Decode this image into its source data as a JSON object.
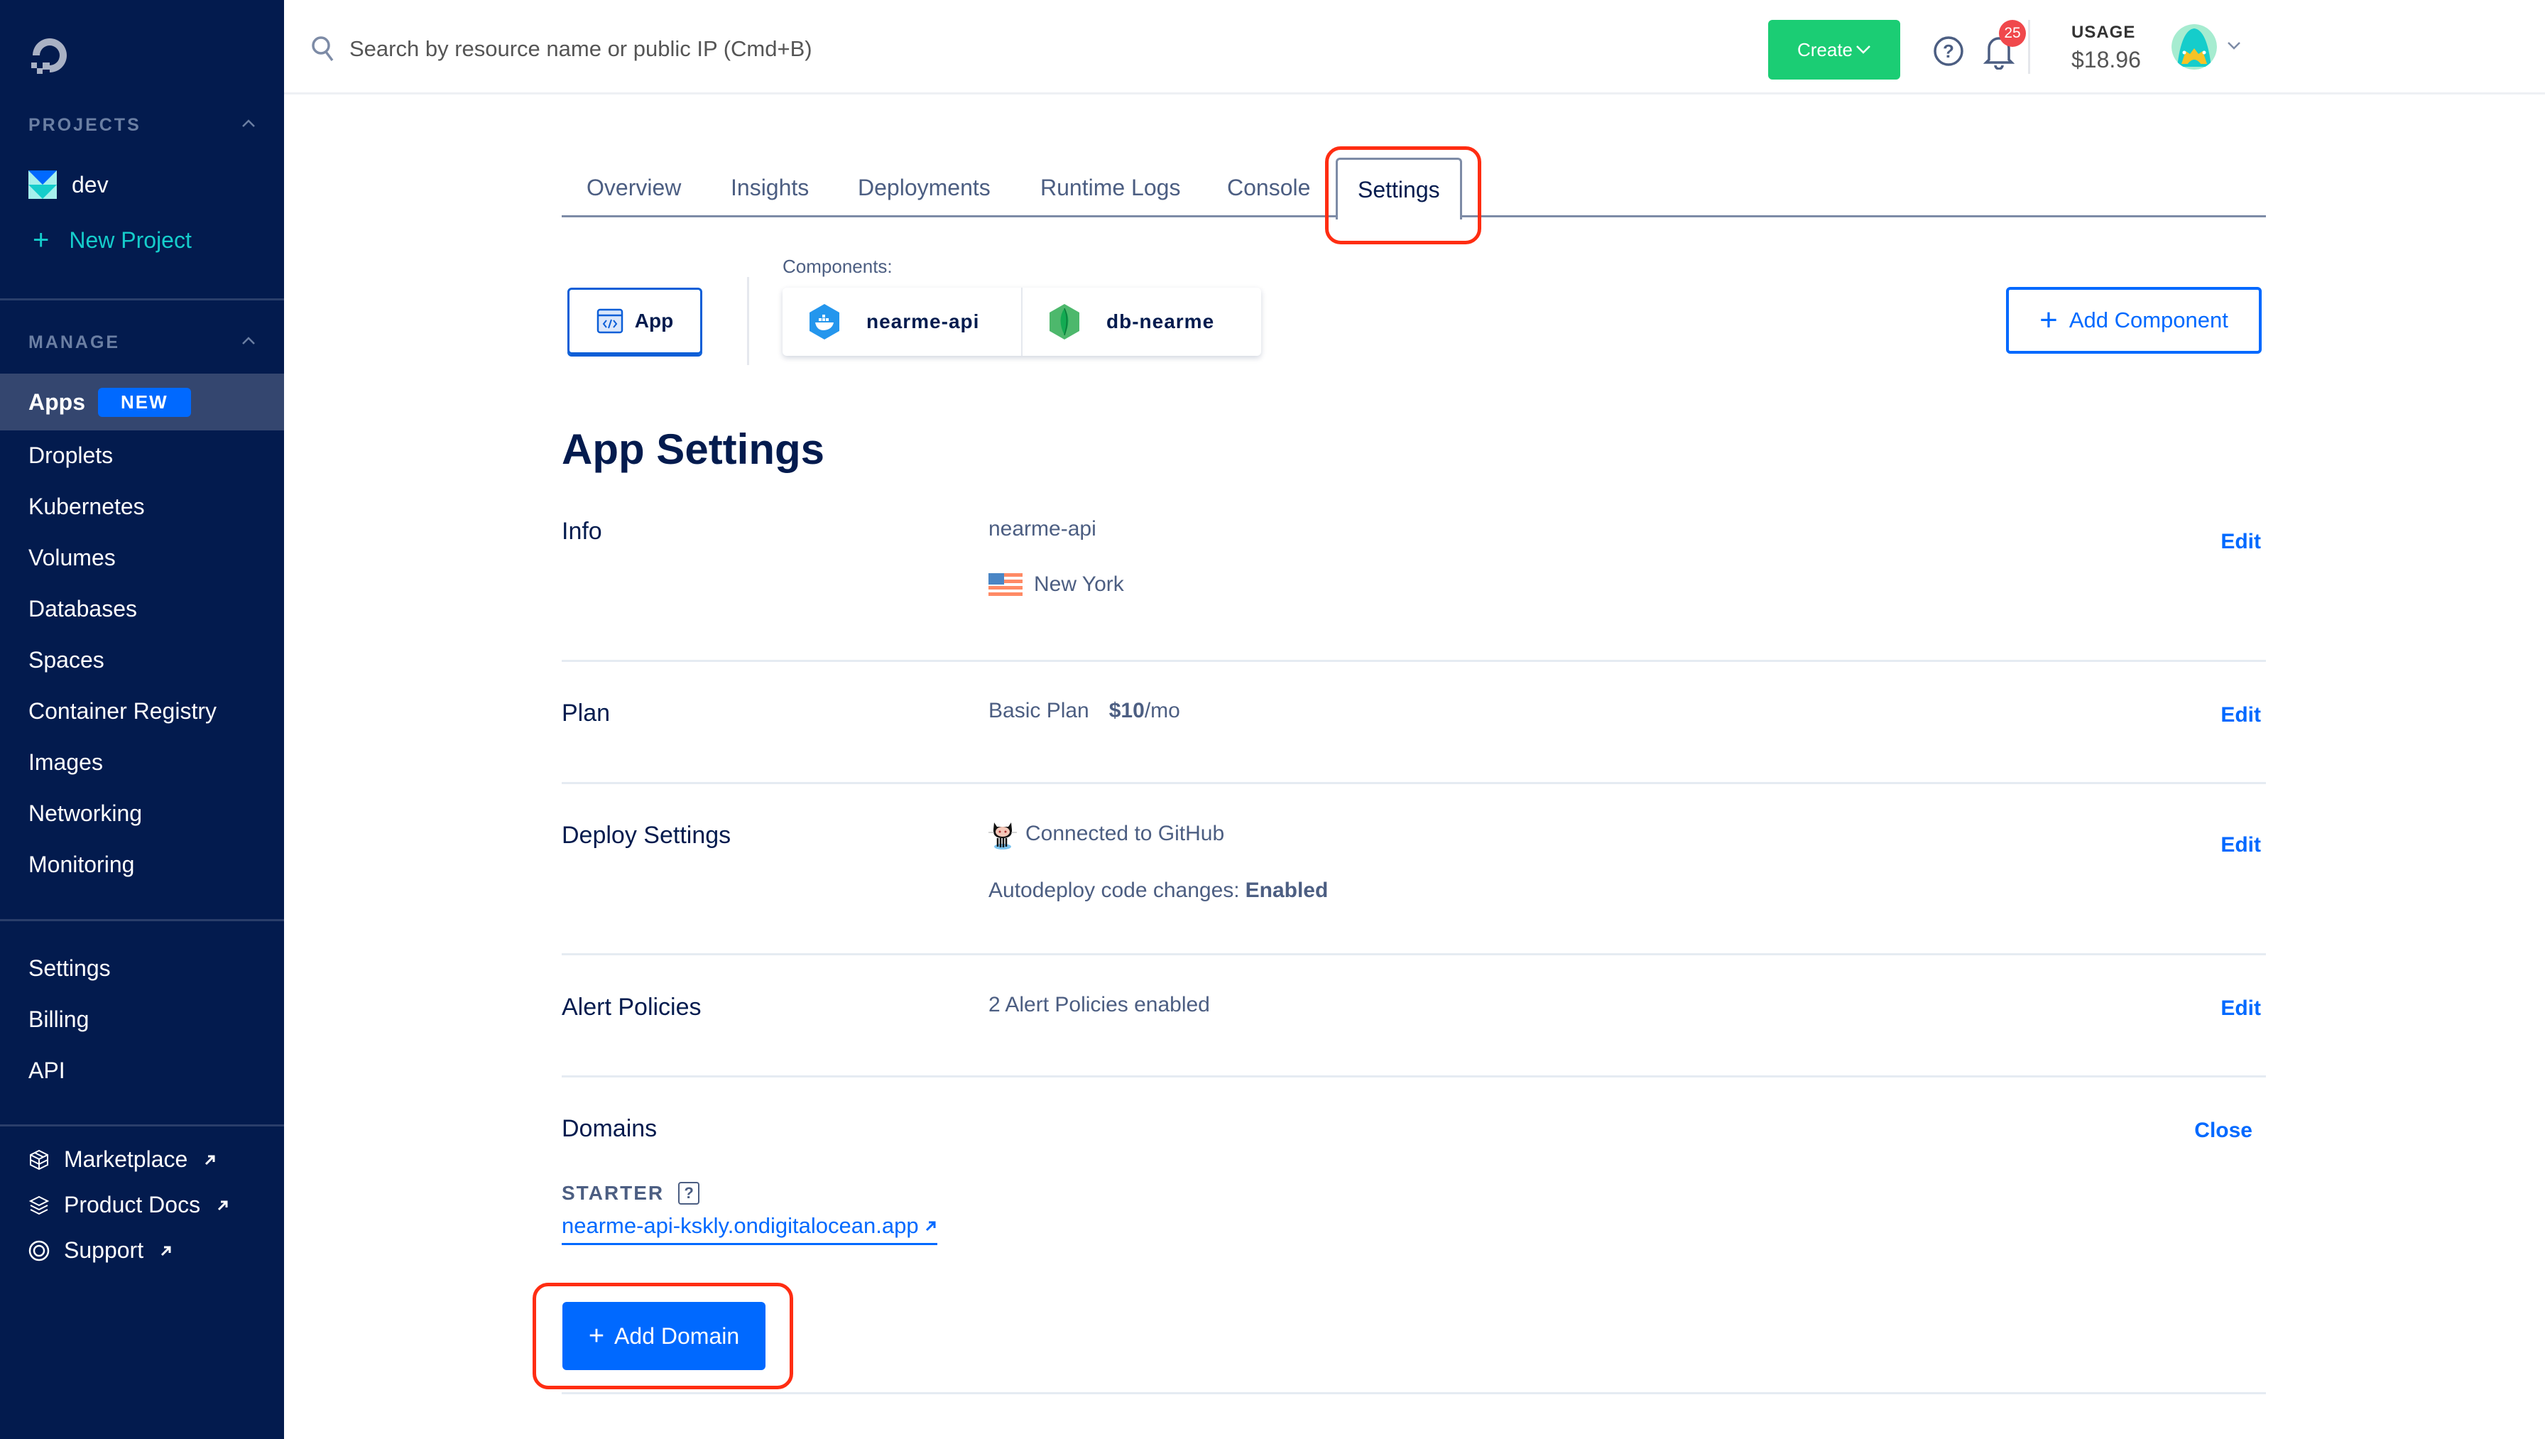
{
  "sidebar": {
    "projects_heading": "PROJECTS",
    "project_name": "dev",
    "new_project": "New Project",
    "manage_heading": "MANAGE",
    "manage_items": [
      {
        "label": "Apps",
        "badge": "NEW",
        "active": true
      },
      {
        "label": "Droplets"
      },
      {
        "label": "Kubernetes"
      },
      {
        "label": "Volumes"
      },
      {
        "label": "Databases"
      },
      {
        "label": "Spaces"
      },
      {
        "label": "Container Registry"
      },
      {
        "label": "Images"
      },
      {
        "label": "Networking"
      },
      {
        "label": "Monitoring"
      }
    ],
    "account_items": [
      {
        "label": "Settings"
      },
      {
        "label": "Billing"
      },
      {
        "label": "API"
      }
    ],
    "external_links": [
      {
        "label": "Marketplace",
        "icon": "cube-icon"
      },
      {
        "label": "Product Docs",
        "icon": "layers-icon"
      },
      {
        "label": "Support",
        "icon": "lifebuoy-icon"
      }
    ]
  },
  "topbar": {
    "search_placeholder": "Search by resource name or public IP (Cmd+B)",
    "create_label": "Create",
    "notification_count": "25",
    "usage_label": "USAGE",
    "usage_value": "$18.96"
  },
  "tabs": [
    {
      "label": "Overview"
    },
    {
      "label": "Insights"
    },
    {
      "label": "Deployments"
    },
    {
      "label": "Runtime Logs"
    },
    {
      "label": "Console"
    },
    {
      "label": "Settings",
      "active": true
    }
  ],
  "components": {
    "app_label": "App",
    "label": "Components:",
    "items": [
      {
        "name": "nearme-api",
        "icon": "docker-icon"
      },
      {
        "name": "db-nearme",
        "icon": "mongodb-icon"
      }
    ],
    "add_label": "Add Component"
  },
  "settings": {
    "title": "App Settings",
    "info": {
      "label": "Info",
      "name": "nearme-api",
      "region": "New York",
      "action": "Edit"
    },
    "plan": {
      "label": "Plan",
      "plan_name": "Basic Plan",
      "price": "$10",
      "period": "/mo",
      "action": "Edit"
    },
    "deploy": {
      "label": "Deploy Settings",
      "source": "Connected to GitHub",
      "autodeploy_label": "Autodeploy code changes:",
      "autodeploy_value": "Enabled",
      "action": "Edit"
    },
    "alerts": {
      "label": "Alert Policies",
      "value": "2 Alert Policies enabled",
      "action": "Edit"
    },
    "domains": {
      "label": "Domains",
      "action": "Close",
      "starter_label": "STARTER",
      "help": "?",
      "starter_domain": "nearme-api-kskly.ondigitalocean.app",
      "add_label": "Add Domain"
    }
  },
  "colors": {
    "sidebar_bg": "#031b4e",
    "accent_blue": "#0069ff",
    "create_green": "#1bcd74",
    "teal": "#15cdcb",
    "badge_red": "#f0484c",
    "annotation_red": "#ff2d12"
  }
}
